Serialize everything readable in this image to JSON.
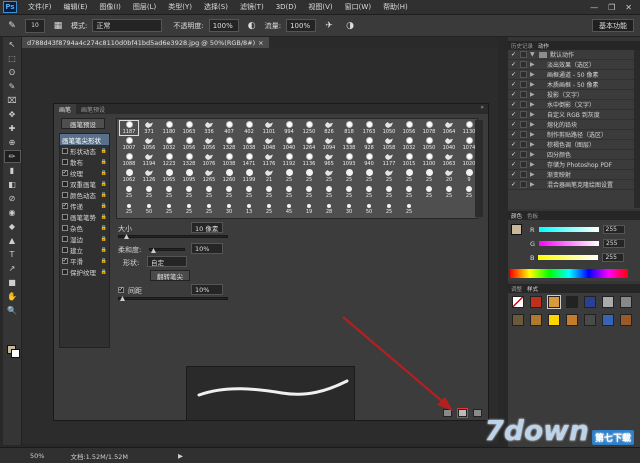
{
  "app": {
    "logo": "Ps"
  },
  "menu": [
    "文件(F)",
    "编辑(E)",
    "图像(I)",
    "图层(L)",
    "类型(Y)",
    "选择(S)",
    "滤镜(T)",
    "3D(D)",
    "视图(V)",
    "窗口(W)",
    "帮助(H)"
  ],
  "window_controls": [
    "—",
    "❐",
    "✕"
  ],
  "options": {
    "brush_size": "10",
    "mode_label": "模式:",
    "mode_value": "正常",
    "opacity_label": "不透明度:",
    "opacity_value": "100%",
    "flow_label": "流量:",
    "flow_value": "100%",
    "workspace": "基本功能"
  },
  "document": {
    "tab_title": "d788d43f8794a4c274c8110d0bf41bd5ad6e3928.jpg @ 50%(RGB/8#)",
    "close": "×"
  },
  "tools": [
    "↖",
    "⬚",
    "ʘ",
    "✎",
    "⌧",
    "✥",
    "✚",
    "⊕",
    "✏",
    "▮",
    "◧",
    "⊘",
    "◉",
    "◆",
    "▲",
    "T",
    "↗",
    "■",
    "✋",
    "🔍"
  ],
  "brush_panel": {
    "tabs": [
      "画笔",
      "画笔预设"
    ],
    "collapse": "»",
    "preset_button": "画笔预设",
    "options": [
      {
        "label": "画笔笔尖形状",
        "checked": false,
        "active": true,
        "has_checkbox": false
      },
      {
        "label": "形状动态",
        "checked": false,
        "active": false,
        "has_checkbox": true
      },
      {
        "label": "散布",
        "checked": false,
        "active": false,
        "has_checkbox": true
      },
      {
        "label": "纹理",
        "checked": true,
        "active": false,
        "has_checkbox": true
      },
      {
        "label": "双重画笔",
        "checked": false,
        "active": false,
        "has_checkbox": true
      },
      {
        "label": "颜色动态",
        "checked": false,
        "active": false,
        "has_checkbox": true
      },
      {
        "label": "传递",
        "checked": true,
        "active": false,
        "has_checkbox": true
      },
      {
        "label": "画笔笔势",
        "checked": false,
        "active": false,
        "has_checkbox": true
      },
      {
        "label": "杂色",
        "checked": false,
        "active": false,
        "has_checkbox": true
      },
      {
        "label": "湿边",
        "checked": false,
        "active": false,
        "has_checkbox": true
      },
      {
        "label": "建立",
        "checked": false,
        "active": false,
        "has_checkbox": true
      },
      {
        "label": "平滑",
        "checked": true,
        "active": false,
        "has_checkbox": true
      },
      {
        "label": "保护纹理",
        "checked": false,
        "active": false,
        "has_checkbox": true
      }
    ],
    "brush_tips": [
      "1187",
      "371",
      "1180",
      "1063",
      "336",
      "407",
      "402",
      "1101",
      "994",
      "1250",
      "826",
      "818",
      "1763",
      "1050",
      "1056",
      "1078",
      "1064",
      "1130",
      "1007",
      "1056",
      "1032",
      "1056",
      "1056",
      "1328",
      "1038",
      "1048",
      "1040",
      "1264",
      "1094",
      "1338",
      "928",
      "1058",
      "1032",
      "1050",
      "1040",
      "1074",
      "1088",
      "1194",
      "1223",
      "1328",
      "1076",
      "1038",
      "1471",
      "1176",
      "1192",
      "1136",
      "965",
      "1093",
      "940",
      "1177",
      "1015",
      "1100",
      "1063",
      "1020",
      "1062",
      "1126",
      "1065",
      "1095",
      "1265",
      "1260",
      "1199",
      "21",
      "25",
      "25",
      "25",
      "25",
      "25",
      "25",
      "25",
      "25",
      "20",
      "9",
      "25",
      "25",
      "25",
      "25",
      "25",
      "25",
      "25",
      "25",
      "25",
      "25",
      "25",
      "25",
      "25",
      "25",
      "25",
      "25",
      "25",
      "25",
      "25",
      "50",
      "25",
      "25",
      "25",
      "30",
      "13",
      "25",
      "45",
      "19",
      "28",
      "30",
      "50",
      "25",
      "25"
    ],
    "size_label": "大小",
    "size_value": "10 像素",
    "softness_label": "柔和度:",
    "softness_value": "10%",
    "shape_label": "形状:",
    "shape_value": "自定",
    "flip_button": "翻转笔尖",
    "spacing_checked": true,
    "spacing_label": "间距",
    "spacing_value": "10%"
  },
  "right_panels": {
    "tabs_top": [
      "历史记录",
      "动作"
    ],
    "actions": [
      {
        "label": "默认动作",
        "checked": true,
        "folder": true,
        "arrow": "▼",
        "indent": false
      },
      {
        "label": "淡出效果（选区）",
        "checked": true,
        "folder": false,
        "arrow": "▶",
        "indent": true
      },
      {
        "label": "画框通道 - 50 像素",
        "checked": true,
        "folder": false,
        "arrow": "▶",
        "indent": true
      },
      {
        "label": "木质画框 - 50 像素",
        "checked": true,
        "folder": false,
        "arrow": "▶",
        "indent": true
      },
      {
        "label": "投影（文字）",
        "checked": true,
        "folder": false,
        "arrow": "▶",
        "indent": true
      },
      {
        "label": "水中倒影（文字）",
        "checked": true,
        "folder": false,
        "arrow": "▶",
        "indent": true
      },
      {
        "label": "自定义 RGB 到灰度",
        "checked": true,
        "folder": false,
        "arrow": "▶",
        "indent": true
      },
      {
        "label": "熔化的铅块",
        "checked": true,
        "folder": false,
        "arrow": "▶",
        "indent": true
      },
      {
        "label": "制作剪贴路径（选区）",
        "checked": true,
        "folder": false,
        "arrow": "▶",
        "indent": true
      },
      {
        "label": "棕褐色调（图层）",
        "checked": true,
        "folder": false,
        "arrow": "▶",
        "indent": true
      },
      {
        "label": "四分颜色",
        "checked": true,
        "folder": false,
        "arrow": "▶",
        "indent": true
      },
      {
        "label": "存储为 Photoshop PDF",
        "checked": true,
        "folder": false,
        "arrow": "▶",
        "indent": true
      },
      {
        "label": "渐变映射",
        "checked": true,
        "folder": false,
        "arrow": "▶",
        "indent": true
      },
      {
        "label": "混合器画笔克隆绘图设置",
        "checked": true,
        "folder": false,
        "arrow": "▶",
        "indent": true
      }
    ],
    "color_tabs": [
      "颜色",
      "色板"
    ],
    "channels": [
      {
        "name": "R",
        "value": "255"
      },
      {
        "name": "G",
        "value": "255"
      },
      {
        "name": "B",
        "value": "255"
      }
    ],
    "style_tabs": [
      "调整",
      "样式"
    ]
  },
  "status": {
    "zoom": "50%",
    "doc_info": "文档:1.52M/1.52M",
    "arrow": "▶"
  },
  "watermark": {
    "text": "7down",
    "sub": "第七下载"
  },
  "colors": {
    "foreground": "#c8b89a",
    "background": "#ffffff"
  }
}
